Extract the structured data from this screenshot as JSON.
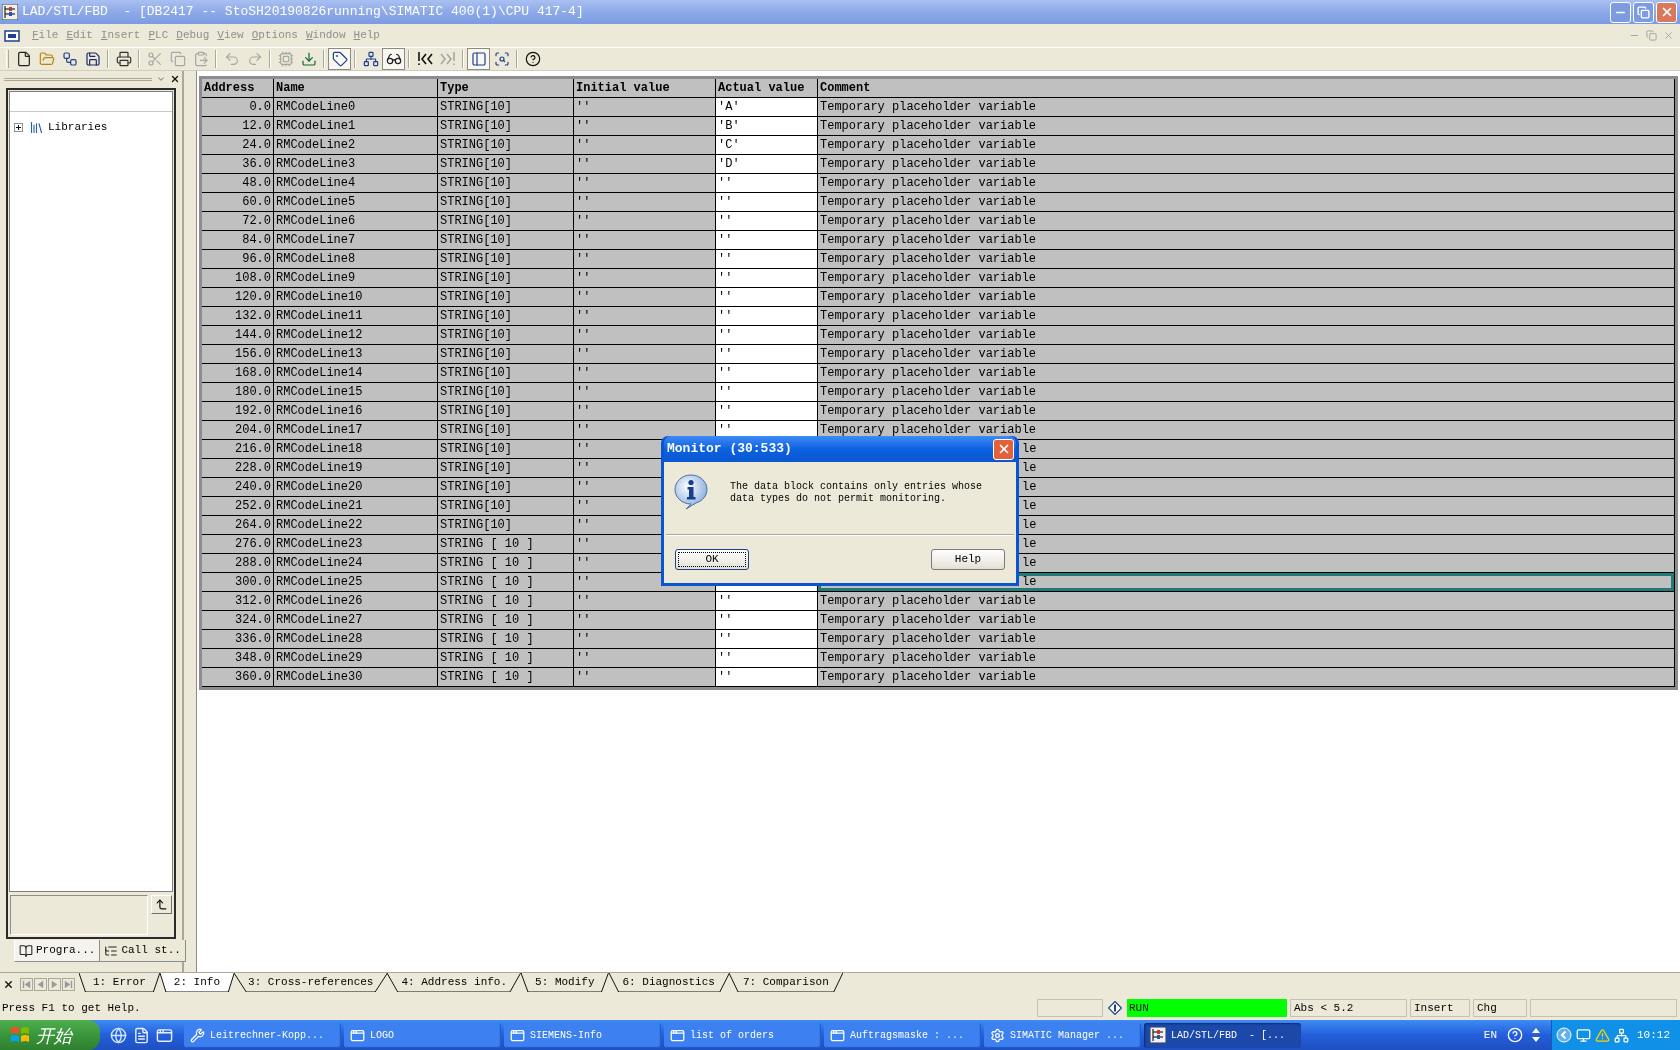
{
  "window": {
    "title": "LAD/STL/FBD  - [DB2417 -- StoSH20190826running\\SIMATIC 400(1)\\CPU 417-4]"
  },
  "menu": [
    {
      "label": "File",
      "disabled": true
    },
    {
      "label": "Edit",
      "disabled": true
    },
    {
      "label": "Insert",
      "disabled": true
    },
    {
      "label": "PLC",
      "disabled": true
    },
    {
      "label": "Debug",
      "disabled": true
    },
    {
      "label": "View",
      "disabled": true
    },
    {
      "label": "Options",
      "disabled": true
    },
    {
      "label": "Window",
      "disabled": true
    },
    {
      "label": "Help",
      "disabled": true
    }
  ],
  "toolbar": [
    [
      {
        "disabled": false,
        "pressed": false
      },
      {
        "disabled": false,
        "pressed": false
      },
      {
        "disabled": false,
        "pressed": false
      },
      {
        "disabled": false,
        "pressed": false
      }
    ],
    [
      {
        "disabled": false,
        "pressed": false
      }
    ],
    [
      {
        "disabled": true,
        "pressed": false
      },
      {
        "disabled": true,
        "pressed": false
      },
      {
        "disabled": true,
        "pressed": false
      }
    ],
    [
      {
        "disabled": true,
        "pressed": false
      },
      {
        "disabled": true,
        "pressed": false
      }
    ],
    [
      {
        "disabled": true,
        "pressed": false
      },
      {
        "disabled": false,
        "pressed": false
      }
    ],
    [
      {
        "disabled": false,
        "pressed": true
      }
    ],
    [
      {
        "disabled": false,
        "pressed": false
      },
      {
        "disabled": false,
        "pressed": true
      }
    ],
    [
      {
        "disabled": false,
        "pressed": false
      },
      {
        "disabled": true,
        "pressed": false
      }
    ],
    [
      {
        "disabled": false,
        "pressed": true
      },
      {
        "disabled": false,
        "pressed": false
      }
    ],
    [
      {
        "disabled": false,
        "pressed": false
      }
    ]
  ],
  "left_panel": {
    "tree": [
      {
        "label": "Libraries",
        "expanded": false
      }
    ],
    "tabs": [
      {
        "label": "Progra...",
        "selected": true
      },
      {
        "label": "Call st..",
        "selected": false
      }
    ]
  },
  "table": {
    "columns": [
      "Address",
      "Name",
      "Type",
      "Initial value",
      "Actual value",
      "Comment"
    ],
    "rows": [
      {
        "address": "0.0",
        "name": "RMCodeLine0",
        "type": "STRING[10]",
        "initial_value": "''",
        "actual_value": "'A'",
        "comment": "Temporary placeholder variable",
        "covered": false,
        "selected": false
      },
      {
        "address": "12.0",
        "name": "RMCodeLine1",
        "type": "STRING[10]",
        "initial_value": "''",
        "actual_value": "'B'",
        "comment": "Temporary placeholder variable",
        "covered": false,
        "selected": false
      },
      {
        "address": "24.0",
        "name": "RMCodeLine2",
        "type": "STRING[10]",
        "initial_value": "''",
        "actual_value": "'C'",
        "comment": "Temporary placeholder variable",
        "covered": false,
        "selected": false
      },
      {
        "address": "36.0",
        "name": "RMCodeLine3",
        "type": "STRING[10]",
        "initial_value": "''",
        "actual_value": "'D'",
        "comment": "Temporary placeholder variable",
        "covered": false,
        "selected": false
      },
      {
        "address": "48.0",
        "name": "RMCodeLine4",
        "type": "STRING[10]",
        "initial_value": "''",
        "actual_value": "''",
        "comment": "Temporary placeholder variable",
        "covered": false,
        "selected": false
      },
      {
        "address": "60.0",
        "name": "RMCodeLine5",
        "type": "STRING[10]",
        "initial_value": "''",
        "actual_value": "''",
        "comment": "Temporary placeholder variable",
        "covered": false,
        "selected": false
      },
      {
        "address": "72.0",
        "name": "RMCodeLine6",
        "type": "STRING[10]",
        "initial_value": "''",
        "actual_value": "''",
        "comment": "Temporary placeholder variable",
        "covered": false,
        "selected": false
      },
      {
        "address": "84.0",
        "name": "RMCodeLine7",
        "type": "STRING[10]",
        "initial_value": "''",
        "actual_value": "''",
        "comment": "Temporary placeholder variable",
        "covered": false,
        "selected": false
      },
      {
        "address": "96.0",
        "name": "RMCodeLine8",
        "type": "STRING[10]",
        "initial_value": "''",
        "actual_value": "''",
        "comment": "Temporary placeholder variable",
        "covered": false,
        "selected": false
      },
      {
        "address": "108.0",
        "name": "RMCodeLine9",
        "type": "STRING[10]",
        "initial_value": "''",
        "actual_value": "''",
        "comment": "Temporary placeholder variable",
        "covered": false,
        "selected": false
      },
      {
        "address": "120.0",
        "name": "RMCodeLine10",
        "type": "STRING[10]",
        "initial_value": "''",
        "actual_value": "''",
        "comment": "Temporary placeholder variable",
        "covered": false,
        "selected": false
      },
      {
        "address": "132.0",
        "name": "RMCodeLine11",
        "type": "STRING[10]",
        "initial_value": "''",
        "actual_value": "''",
        "comment": "Temporary placeholder variable",
        "covered": false,
        "selected": false
      },
      {
        "address": "144.0",
        "name": "RMCodeLine12",
        "type": "STRING[10]",
        "initial_value": "''",
        "actual_value": "''",
        "comment": "Temporary placeholder variable",
        "covered": false,
        "selected": false
      },
      {
        "address": "156.0",
        "name": "RMCodeLine13",
        "type": "STRING[10]",
        "initial_value": "''",
        "actual_value": "''",
        "comment": "Temporary placeholder variable",
        "covered": false,
        "selected": false
      },
      {
        "address": "168.0",
        "name": "RMCodeLine14",
        "type": "STRING[10]",
        "initial_value": "''",
        "actual_value": "''",
        "comment": "Temporary placeholder variable",
        "covered": false,
        "selected": false
      },
      {
        "address": "180.0",
        "name": "RMCodeLine15",
        "type": "STRING[10]",
        "initial_value": "''",
        "actual_value": "''",
        "comment": "Temporary placeholder variable",
        "covered": false,
        "selected": false
      },
      {
        "address": "192.0",
        "name": "RMCodeLine16",
        "type": "STRING[10]",
        "initial_value": "''",
        "actual_value": "''",
        "comment": "Temporary placeholder variable",
        "covered": false,
        "selected": false
      },
      {
        "address": "204.0",
        "name": "RMCodeLine17",
        "type": "STRING[10]",
        "initial_value": "''",
        "actual_value": "''",
        "comment": "Temporary placeholder variable",
        "covered": false,
        "selected": false
      },
      {
        "address": "216.0",
        "name": "RMCodeLine18",
        "type": "STRING[10]",
        "initial_value": "''",
        "comment": "le",
        "covered": true,
        "selected": false
      },
      {
        "address": "228.0",
        "name": "RMCodeLine19",
        "type": "STRING[10]",
        "initial_value": "''",
        "comment": "le",
        "covered": true,
        "selected": false
      },
      {
        "address": "240.0",
        "name": "RMCodeLine20",
        "type": "STRING[10]",
        "initial_value": "''",
        "comment": "le",
        "covered": true,
        "selected": false
      },
      {
        "address": "252.0",
        "name": "RMCodeLine21",
        "type": "STRING[10]",
        "initial_value": "''",
        "comment": "le",
        "covered": true,
        "selected": false
      },
      {
        "address": "264.0",
        "name": "RMCodeLine22",
        "type": "STRING[10]",
        "initial_value": "''",
        "comment": "le",
        "covered": true,
        "selected": false
      },
      {
        "address": "276.0",
        "name": "RMCodeLine23",
        "type": "STRING [ 10 ]",
        "initial_value": "''",
        "comment": "le",
        "covered": true,
        "selected": false
      },
      {
        "address": "288.0",
        "name": "RMCodeLine24",
        "type": "STRING [ 10 ]",
        "initial_value": "''",
        "comment": "le",
        "covered": true,
        "selected": false
      },
      {
        "address": "300.0",
        "name": "RMCodeLine25",
        "type": "STRING [ 10 ]",
        "initial_value": "''",
        "comment": "le",
        "covered": true,
        "selected": true
      },
      {
        "address": "312.0",
        "name": "RMCodeLine26",
        "type": "STRING [ 10 ]",
        "initial_value": "''",
        "actual_value": "''",
        "comment": "Temporary placeholder variable",
        "covered": false,
        "selected": false
      },
      {
        "address": "324.0",
        "name": "RMCodeLine27",
        "type": "STRING [ 10 ]",
        "initial_value": "''",
        "actual_value": "''",
        "comment": "Temporary placeholder variable",
        "covered": false,
        "selected": false
      },
      {
        "address": "336.0",
        "name": "RMCodeLine28",
        "type": "STRING [ 10 ]",
        "initial_value": "''",
        "actual_value": "''",
        "comment": "Temporary placeholder variable",
        "covered": false,
        "selected": false
      },
      {
        "address": "348.0",
        "name": "RMCodeLine29",
        "type": "STRING [ 10 ]",
        "initial_value": "''",
        "actual_value": "''",
        "comment": "Temporary placeholder variable",
        "covered": false,
        "selected": false
      },
      {
        "address": "360.0",
        "name": "RMCodeLine30",
        "type": "STRING [ 10 ]",
        "initial_value": "''",
        "actual_value": "''",
        "comment": "Temporary placeholder variable",
        "covered": false,
        "selected": false
      }
    ]
  },
  "dialog": {
    "title": "Monitor (30:533)",
    "message": "The data block contains only entries whose data types do not permit monitoring.",
    "buttons": [
      {
        "label": "OK",
        "focused": true
      },
      {
        "label": "Help",
        "focused": false
      }
    ]
  },
  "output_tabs": [
    {
      "label": "1: Error",
      "selected": false
    },
    {
      "label": "2: Info",
      "selected": true
    },
    {
      "label": "3: Cross-references",
      "selected": false
    },
    {
      "label": "4: Address info.",
      "selected": false
    },
    {
      "label": "5: Modify",
      "selected": false
    },
    {
      "label": "6: Diagnostics",
      "selected": false
    },
    {
      "label": "7: Comparison",
      "selected": false
    }
  ],
  "status_bar": {
    "message": "Press F1 to get Help.",
    "cpu_state": "RUN",
    "position": "Abs < 5.2",
    "mode": "Insert",
    "edit_state": "Chg"
  },
  "taskbar": {
    "start": "开始",
    "tasks": [
      {
        "label": "Leitrechner-Kopp...",
        "selected": false
      },
      {
        "label": "LOGO",
        "selected": false
      },
      {
        "label": "SIEMENS-Info",
        "selected": false
      },
      {
        "label": "list of orders",
        "selected": false
      },
      {
        "label": "Auftragsmaske : ...",
        "selected": false
      },
      {
        "label": "SIMATIC Manager ...",
        "selected": false
      },
      {
        "label": "LAD/STL/FBD  - [...",
        "selected": true
      }
    ],
    "language": "EN",
    "clock": "10:12"
  }
}
